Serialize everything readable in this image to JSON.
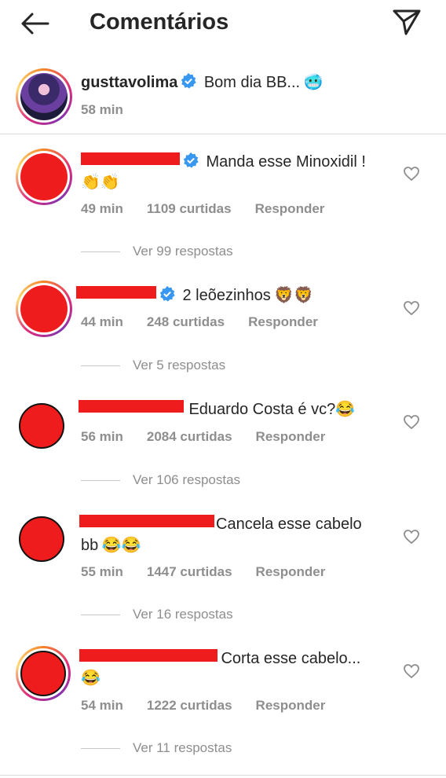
{
  "header": {
    "title": "Comentários",
    "back_icon": "arrow-left-icon",
    "share_icon": "paper-plane-icon"
  },
  "caption": {
    "author": "gusttavolima",
    "text": "Bom dia BB...",
    "emoji": "🥶",
    "time": "58 min"
  },
  "comments": [
    {
      "text": "Manda esse Minoxidil !",
      "emoji": "👏👏",
      "time": "49 min",
      "likes": "1109 curtidas",
      "reply": "Responder",
      "view_replies": "Ver 99 respostas"
    },
    {
      "text": "2 leõezinhos",
      "emoji": "🦁🦁",
      "time": "44 min",
      "likes": "248 curtidas",
      "reply": "Responder",
      "view_replies": "Ver 5 respostas"
    },
    {
      "text": "Eduardo Costa é vc?",
      "emoji": "😂",
      "time": "56 min",
      "likes": "2084 curtidas",
      "reply": "Responder",
      "view_replies": "Ver 106 respostas"
    },
    {
      "text": "Cancela esse cabelo",
      "text2": "bb",
      "emoji": "😂😂",
      "time": "55 min",
      "likes": "1447 curtidas",
      "reply": "Responder",
      "view_replies": "Ver 16 respostas"
    },
    {
      "text": "Corta esse cabelo...",
      "emoji": "😂",
      "time": "54 min",
      "likes": "1222 curtidas",
      "reply": "Responder",
      "view_replies": "Ver 11 respostas"
    }
  ],
  "colors": {
    "redaction": "#ee1c1c",
    "verified": "#3897f0",
    "secondary_text": "#8e8e8e"
  }
}
